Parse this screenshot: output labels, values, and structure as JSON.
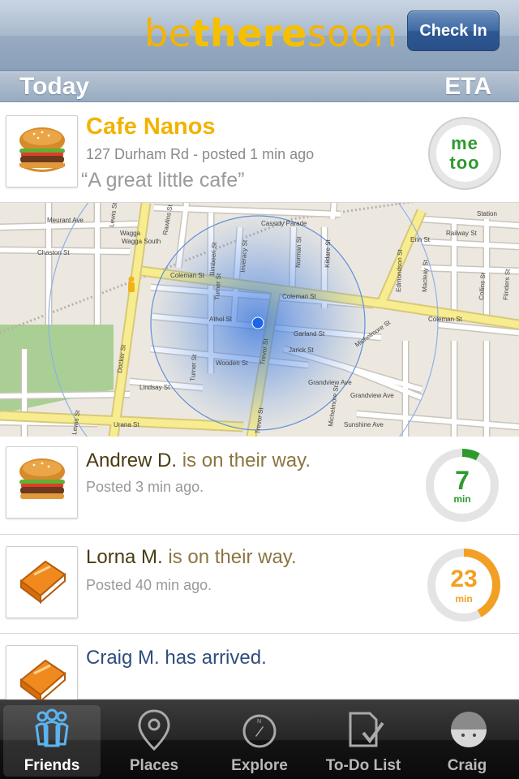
{
  "header": {
    "logo_part1": "be",
    "logo_part2": "there",
    "logo_part3": "soon",
    "checkin_label": "Check In"
  },
  "section": {
    "left": "Today",
    "right": "ETA"
  },
  "place": {
    "name": "Cafe Nanos",
    "address": "127 Durham Rd - posted 1 min ago",
    "quote": "“A great little cafe”",
    "metoo_line1": "me",
    "metoo_line2": "too",
    "icon": "burger-icon"
  },
  "map": {
    "streets": [
      "Lewis St",
      "Meurant Ave",
      "Wagga Wagga South",
      "Chaston St",
      "Bimbeeri St",
      "Inveracy St",
      "Cassidy Parade",
      "Norman St",
      "Kildare St",
      "Rawlins St",
      "Coleman St",
      "Turner St",
      "Athol St",
      "Trevor St",
      "Garland St",
      "Jarick St",
      "Wooden St",
      "Lindsay St",
      "Docker St",
      "Urana St",
      "Michelmore St",
      "Sunshine Ave",
      "Grandview Ave",
      "Erin St",
      "Railway St",
      "Collins St",
      "Flinders St",
      "Macleay St",
      "Edmondson St",
      "Station"
    ],
    "accuracy_color": "#3e7bdf"
  },
  "friends": [
    {
      "name": "Andrew D.",
      "action": "is on their way.",
      "meta": "Posted 3 min ago.",
      "icon": "burger-icon",
      "eta": "7",
      "unit": "min",
      "progress": 0.08,
      "color": "#2e9a2e"
    },
    {
      "name": "Lorna M.",
      "action": "is on their way.",
      "meta": "Posted 40 min ago.",
      "icon": "book-icon",
      "eta": "23",
      "unit": "min",
      "progress": 0.42,
      "color": "#f2a024"
    },
    {
      "name": "Craig M.",
      "action": "has arrived.",
      "meta": "",
      "icon": "book-icon"
    }
  ],
  "tabs": [
    {
      "label": "Friends",
      "icon": "friends-icon",
      "active": true
    },
    {
      "label": "Places",
      "icon": "map-pin-icon",
      "active": false
    },
    {
      "label": "Explore",
      "icon": "compass-icon",
      "active": false
    },
    {
      "label": "To-Do List",
      "icon": "todo-list-icon",
      "active": false
    },
    {
      "label": "Craig",
      "icon": "avatar-icon",
      "active": false
    }
  ]
}
